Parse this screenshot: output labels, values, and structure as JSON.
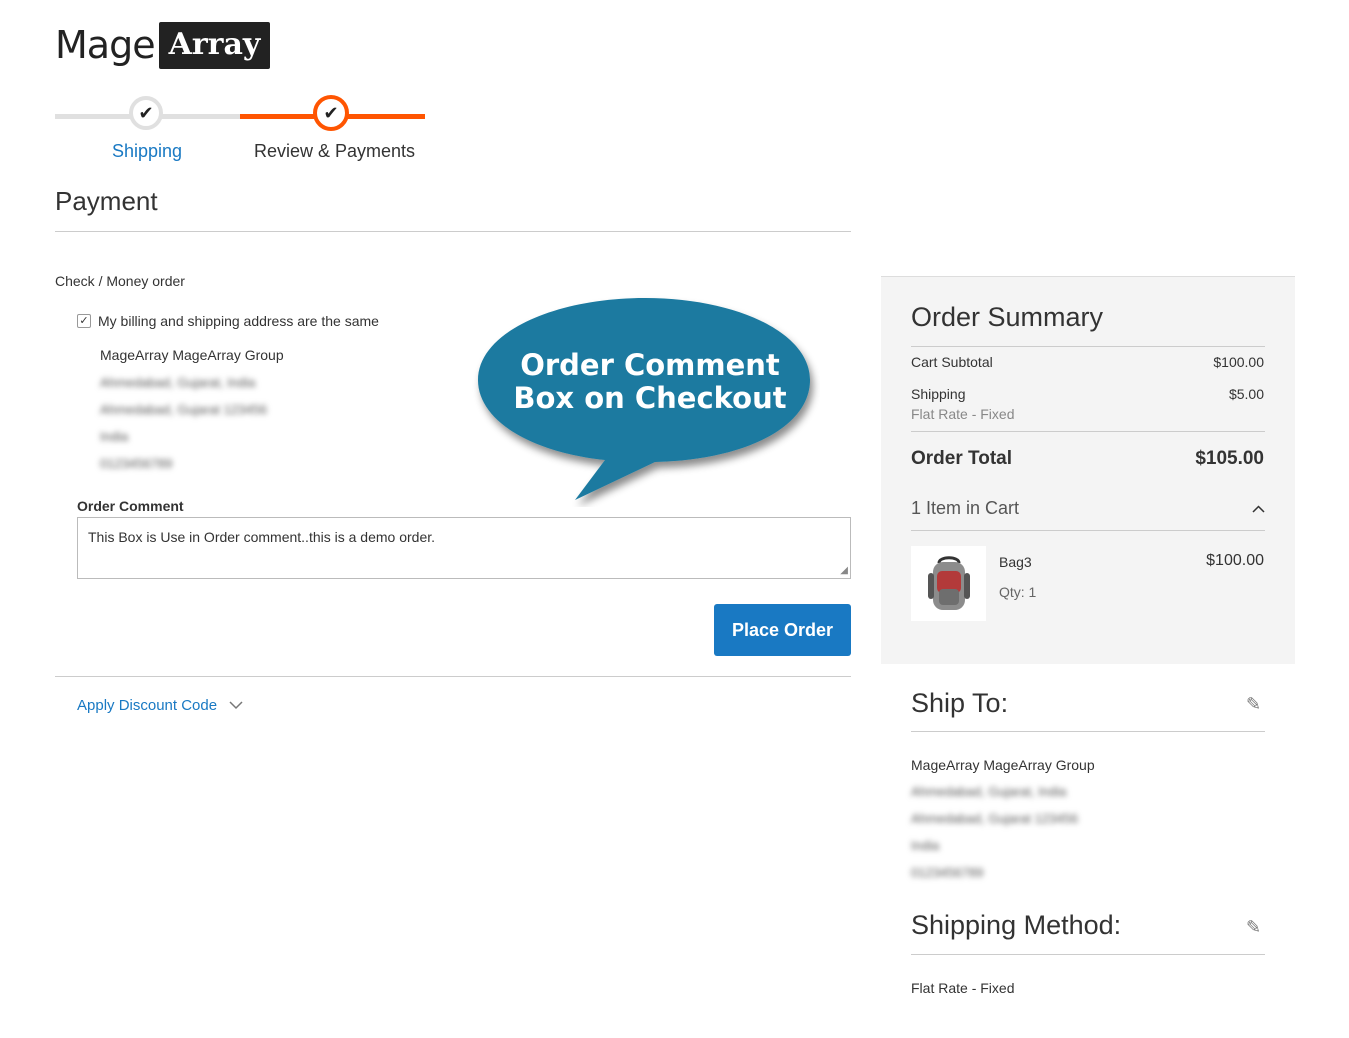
{
  "logo": {
    "part1": "Mage",
    "part2": "Array"
  },
  "steps": [
    {
      "label": "Shipping",
      "state": "complete"
    },
    {
      "label": "Review & Payments",
      "state": "active"
    }
  ],
  "payment": {
    "title": "Payment",
    "method": "Check / Money order",
    "same_address_label": "My billing and shipping address are the same",
    "same_address_checked": true,
    "address_name": "MageArray MageArray Group",
    "address_lines_blurred": [
      "Ahmedabad, Gujarat, India",
      "Ahmedabad, Gujarat 123456",
      "India",
      "0123456789"
    ],
    "comment_label": "Order Comment",
    "comment_value": "This Box is Use in Order comment..this is a demo order.",
    "place_order": "Place Order",
    "discount_link": "Apply Discount Code"
  },
  "callout": {
    "line1": "Order Comment",
    "line2": "Box on Checkout",
    "color": "#1a7aa0"
  },
  "summary": {
    "title": "Order Summary",
    "subtotal_label": "Cart Subtotal",
    "subtotal_value": "$100.00",
    "shipping_label": "Shipping",
    "shipping_value": "$5.00",
    "shipping_method": "Flat Rate - Fixed",
    "total_label": "Order Total",
    "total_value": "$105.00",
    "items_label": "1 Item in Cart",
    "item": {
      "name": "Bag3",
      "qty": "Qty: 1",
      "price": "$100.00"
    }
  },
  "ship_to": {
    "title": "Ship To:",
    "name": "MageArray MageArray Group",
    "lines_blurred": [
      "Ahmedabad, Gujarat, India",
      "Ahmedabad, Gujarat 123456",
      "India",
      "0123456789"
    ]
  },
  "shipping_method": {
    "title": "Shipping Method:",
    "value": "Flat Rate - Fixed"
  },
  "colors": {
    "accent": "#ff5501",
    "link": "#1979c3",
    "button": "#1979c3"
  }
}
